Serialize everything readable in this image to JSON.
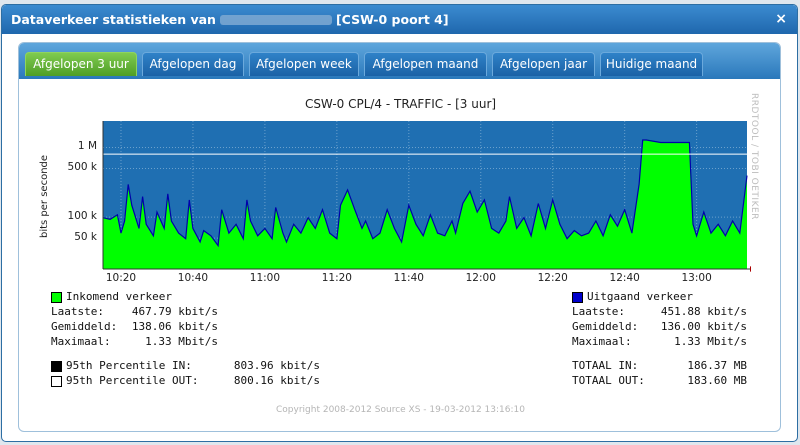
{
  "dialog": {
    "title_prefix": "Dataverkeer statistieken van",
    "title_suffix": "[CSW-0 poort 4]",
    "close_label": "×"
  },
  "tabs": [
    {
      "label": "Afgelopen 3 uur",
      "active": true
    },
    {
      "label": "Afgelopen dag",
      "active": false
    },
    {
      "label": "Afgelopen week",
      "active": false
    },
    {
      "label": "Afgelopen maand",
      "active": false
    },
    {
      "label": "Afgelopen jaar",
      "active": false
    },
    {
      "label": "Huidige maand",
      "active": false
    }
  ],
  "chart_data": {
    "type": "area",
    "title": "CSW-0 CPL/4 - TRAFFIC - [3 uur]",
    "ylabel": "bits per seconde",
    "side_label": "RRDTOOL / TOBI OETIKER",
    "y_scale": "log",
    "ylim": [
      18000,
      2400000
    ],
    "y_ticks": [
      {
        "value": 50000,
        "label": "50 k"
      },
      {
        "value": 100000,
        "label": "100 k"
      },
      {
        "value": 500000,
        "label": "500 k"
      },
      {
        "value": 1000000,
        "label": "1 M"
      }
    ],
    "x_ticks": [
      {
        "minutes": 0,
        "label": "10:20"
      },
      {
        "minutes": 20,
        "label": "10:40"
      },
      {
        "minutes": 40,
        "label": "11:00"
      },
      {
        "minutes": 60,
        "label": "11:20"
      },
      {
        "minutes": 80,
        "label": "11:40"
      },
      {
        "minutes": 100,
        "label": "12:00"
      },
      {
        "minutes": 120,
        "label": "12:20"
      },
      {
        "minutes": 140,
        "label": "12:40"
      },
      {
        "minutes": 160,
        "label": "13:00"
      }
    ],
    "x_range": [
      -5,
      174
    ],
    "percentile_line": 803960,
    "colors": {
      "inbound": "#00ff00",
      "outbound": "#0000aa",
      "background": "#1f6fb2",
      "percentile": "#ffffff"
    },
    "series": [
      {
        "name": "Inkomend verkeer",
        "x": [
          -5,
          -3,
          -1,
          0,
          1,
          2,
          3,
          5,
          6,
          7,
          9,
          10,
          12,
          13,
          14,
          16,
          18,
          19,
          20,
          22,
          23,
          25,
          27,
          28,
          30,
          32,
          34,
          35,
          36,
          38,
          40,
          42,
          43,
          45,
          46,
          48,
          50,
          52,
          54,
          56,
          58,
          60,
          61,
          63,
          65,
          67,
          68,
          70,
          72,
          74,
          76,
          78,
          80,
          82,
          84,
          86,
          88,
          90,
          92,
          93,
          95,
          97,
          99,
          101,
          103,
          105,
          107,
          108,
          110,
          112,
          114,
          116,
          118,
          120,
          122,
          124,
          126,
          128,
          130,
          132,
          134,
          136,
          138,
          140,
          142,
          144,
          145,
          146,
          150,
          155,
          158,
          159,
          160,
          162,
          164,
          166,
          168,
          170,
          172,
          174
        ],
        "y": [
          100000,
          95000,
          110000,
          60000,
          90000,
          300000,
          150000,
          70000,
          200000,
          80000,
          55000,
          120000,
          70000,
          220000,
          90000,
          60000,
          50000,
          180000,
          70000,
          45000,
          65000,
          55000,
          40000,
          130000,
          60000,
          80000,
          50000,
          180000,
          90000,
          55000,
          70000,
          50000,
          140000,
          60000,
          45000,
          80000,
          60000,
          100000,
          70000,
          130000,
          60000,
          50000,
          150000,
          250000,
          130000,
          70000,
          90000,
          50000,
          60000,
          130000,
          70000,
          45000,
          150000,
          80000,
          55000,
          110000,
          60000,
          55000,
          90000,
          60000,
          160000,
          240000,
          120000,
          180000,
          70000,
          60000,
          90000,
          200000,
          70000,
          100000,
          55000,
          160000,
          70000,
          180000,
          80000,
          50000,
          65000,
          55000,
          60000,
          90000,
          55000,
          110000,
          75000,
          130000,
          60000,
          300000,
          1300000,
          1300000,
          1200000,
          1200000,
          1200000,
          80000,
          55000,
          120000,
          60000,
          80000,
          55000,
          90000,
          60000,
          400000
        ]
      },
      {
        "name": "Uitgaand verkeer",
        "x": [
          -5,
          -3,
          -1,
          0,
          1,
          2,
          3,
          5,
          6,
          7,
          9,
          10,
          12,
          13,
          14,
          16,
          18,
          19,
          20,
          22,
          23,
          25,
          27,
          28,
          30,
          32,
          34,
          35,
          36,
          38,
          40,
          42,
          43,
          45,
          46,
          48,
          50,
          52,
          54,
          56,
          58,
          60,
          61,
          63,
          65,
          67,
          68,
          70,
          72,
          74,
          76,
          78,
          80,
          82,
          84,
          86,
          88,
          90,
          92,
          93,
          95,
          97,
          99,
          101,
          103,
          105,
          107,
          108,
          110,
          112,
          114,
          116,
          118,
          120,
          122,
          124,
          126,
          128,
          130,
          132,
          134,
          136,
          138,
          140,
          142,
          144,
          145,
          146,
          150,
          155,
          158,
          159,
          160,
          162,
          164,
          166,
          168,
          170,
          172,
          174
        ],
        "y": [
          98000,
          93000,
          108000,
          59000,
          88000,
          295000,
          148000,
          69000,
          197000,
          79000,
          54000,
          118000,
          69000,
          216000,
          88000,
          59000,
          49000,
          177000,
          69000,
          44000,
          64000,
          54000,
          39000,
          128000,
          59000,
          79000,
          49000,
          177000,
          88000,
          54000,
          69000,
          49000,
          138000,
          59000,
          44000,
          79000,
          59000,
          98000,
          69000,
          128000,
          59000,
          49000,
          148000,
          246000,
          128000,
          69000,
          88000,
          49000,
          59000,
          128000,
          69000,
          44000,
          148000,
          79000,
          54000,
          108000,
          59000,
          54000,
          88000,
          59000,
          157000,
          236000,
          118000,
          177000,
          69000,
          59000,
          88000,
          197000,
          69000,
          98000,
          54000,
          157000,
          69000,
          177000,
          79000,
          49000,
          64000,
          54000,
          59000,
          88000,
          54000,
          108000,
          74000,
          128000,
          59000,
          295000,
          1280000,
          1280000,
          1180000,
          1180000,
          1180000,
          79000,
          54000,
          118000,
          59000,
          79000,
          54000,
          88000,
          59000,
          395000
        ]
      }
    ]
  },
  "legend": {
    "in": {
      "title": "Inkomend verkeer",
      "color": "#00ff00",
      "rows": [
        {
          "label": "Laatste:",
          "value": "467.79 kbit/s"
        },
        {
          "label": "Gemiddeld:",
          "value": "138.06 kbit/s"
        },
        {
          "label": "Maximaal:",
          "value": "1.33 Mbit/s"
        }
      ]
    },
    "out": {
      "title": "Uitgaand verkeer",
      "color": "#0000cc",
      "rows": [
        {
          "label": "Laatste:",
          "value": "451.88 kbit/s"
        },
        {
          "label": "Gemiddeld:",
          "value": "136.00 kbit/s"
        },
        {
          "label": "Maximaal:",
          "value": "1.33 Mbit/s"
        }
      ]
    },
    "percentiles": [
      {
        "label": "95th Percentile IN:",
        "value": "803.96 kbit/s",
        "swatch": "#000000"
      },
      {
        "label": "95th Percentile OUT:",
        "value": "800.16 kbit/s",
        "swatch": "#ffffff"
      }
    ],
    "totals": [
      {
        "label": "TOTAAL IN:",
        "value": "186.37 MB"
      },
      {
        "label": "TOTAAL OUT:",
        "value": "183.60 MB"
      }
    ]
  },
  "copyright": "Copyright 2008-2012 Source XS - 19-03-2012 13:16:10"
}
